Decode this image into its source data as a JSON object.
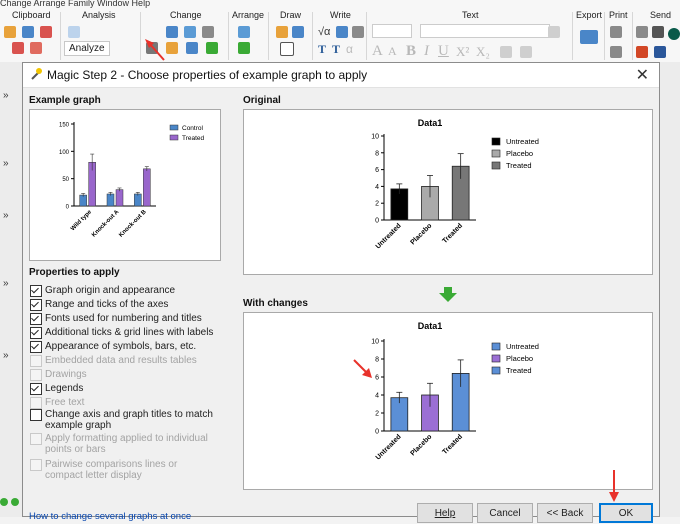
{
  "app": {
    "menubar": "Change  Arrange  Family  Window  Help",
    "ribbon_groups": [
      "Clipboard",
      "Analysis",
      "Change",
      "Arrange",
      "Draw",
      "Write",
      "Text",
      "Export",
      "Print",
      "Send"
    ],
    "analyze_label": "Analyze",
    "write_icons": [
      "√α",
      "T",
      "T",
      "α"
    ],
    "text_format_glyphs": [
      "A",
      "A",
      "B",
      "I",
      "U",
      "X²",
      "X₂"
    ]
  },
  "dialog": {
    "title": "Magic Step 2 - Choose properties of example graph to apply",
    "example_heading": "Example graph",
    "original_heading": "Original",
    "changes_heading": "With changes",
    "properties_heading": "Properties to apply",
    "properties": [
      {
        "label": "Graph origin and appearance",
        "checked": true,
        "enabled": true
      },
      {
        "label": "Range and ticks of the axes",
        "checked": true,
        "enabled": true
      },
      {
        "label": "Fonts used for numbering and titles",
        "checked": true,
        "enabled": true
      },
      {
        "label": "Additional ticks & grid lines with labels",
        "checked": true,
        "enabled": true
      },
      {
        "label": "Appearance of symbols, bars, etc.",
        "checked": true,
        "enabled": true
      },
      {
        "label": "Embedded data and results tables",
        "checked": false,
        "enabled": false
      },
      {
        "label": "Drawings",
        "checked": false,
        "enabled": false
      },
      {
        "label": "Legends",
        "checked": true,
        "enabled": true
      },
      {
        "label": "Free text",
        "checked": false,
        "enabled": false
      },
      {
        "label": "Change axis and graph titles to match example graph",
        "checked": false,
        "enabled": true
      },
      {
        "label": "Apply formatting applied to individual points or bars",
        "checked": false,
        "enabled": false
      },
      {
        "label": "Pairwise comparisons lines or compact letter display",
        "checked": false,
        "enabled": false
      }
    ],
    "help_link": "How to change several graphs at once",
    "buttons": {
      "help": "Help",
      "cancel": "Cancel",
      "back": "<< Back",
      "ok": "OK"
    }
  },
  "chart_data": [
    {
      "type": "bar",
      "name": "example",
      "categories": [
        "Wild type",
        "Knock-out A",
        "Knock-out B"
      ],
      "series": [
        {
          "name": "Control",
          "values": [
            20,
            22,
            22
          ],
          "errors": [
            3,
            3,
            3
          ],
          "color": "#4a86c8"
        },
        {
          "name": "Treated",
          "values": [
            80,
            30,
            68
          ],
          "errors": [
            15,
            3,
            4
          ],
          "color": "#9966cc"
        }
      ],
      "yticks": [
        0,
        50,
        100,
        150
      ],
      "ylim": [
        0,
        150
      ],
      "legend": "top-right"
    },
    {
      "type": "bar",
      "name": "original",
      "title": "Data1",
      "categories": [
        "Untreated",
        "Placebo",
        "Treated"
      ],
      "values": [
        3.7,
        4.0,
        6.4
      ],
      "errors": [
        0.6,
        1.3,
        1.5
      ],
      "colors": [
        "#000000",
        "#aaaaaa",
        "#777777"
      ],
      "legend_entries": [
        "Untreated",
        "Placebo",
        "Treated"
      ],
      "yticks": [
        0,
        2,
        4,
        6,
        8,
        10
      ],
      "ylim": [
        0,
        10
      ],
      "legend": "top-right"
    },
    {
      "type": "bar",
      "name": "with_changes",
      "title": "Data1",
      "categories": [
        "Untreated",
        "Placebo",
        "Treated"
      ],
      "values": [
        3.7,
        4.0,
        6.4
      ],
      "errors": [
        0.6,
        1.3,
        1.5
      ],
      "colors": [
        "#5b8fd6",
        "#9b6fd4",
        "#5b8fd6"
      ],
      "legend_entries": [
        "Untreated",
        "Placebo",
        "Treated"
      ],
      "yticks": [
        0,
        2,
        4,
        6,
        8,
        10
      ],
      "ylim": [
        0,
        10
      ],
      "legend": "top-right"
    }
  ],
  "colors": {
    "accent": "#0078d7",
    "annotation_arrow": "#e8322b",
    "flow_arrow": "#3aaa35"
  }
}
